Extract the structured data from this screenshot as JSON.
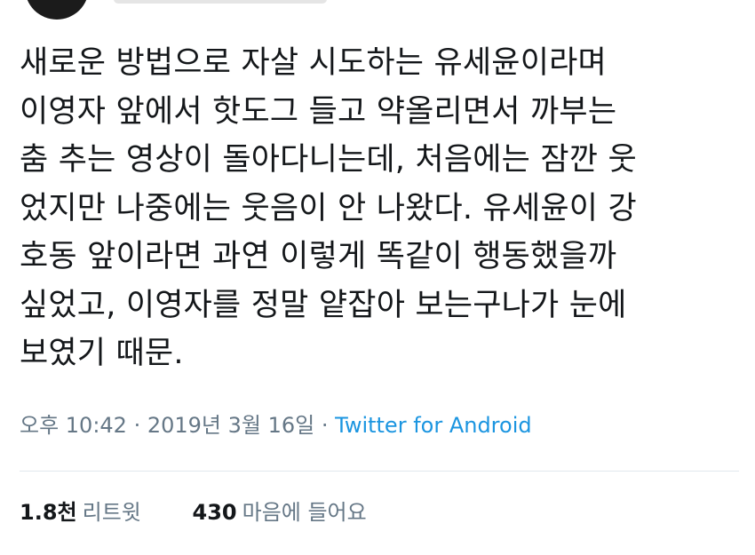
{
  "tweet": {
    "lines": [
      "새로운 방법으로 자살 시도하는 유세윤이라며",
      "이영자 앞에서 핫도그 들고 약올리면서 까부는",
      "춤 추는 영상이 돌아다니는데, 처음에는 잠깐 웃",
      "었지만 나중에는 웃음이 안 나왔다. 유세윤이 강",
      "호동 앞이라면 과연 이렇게 똑같이 행동했을까",
      "싶었고, 이영자를 정말 얕잡아 보는구나가 눈에",
      "보였기 때문."
    ]
  },
  "meta": {
    "time": "오후 10:42",
    "separator1": " · ",
    "date": "2019년 3월 16일",
    "separator2": " · ",
    "source": "Twitter for Android"
  },
  "stats": {
    "retweets_count": "1.8천",
    "retweets_label": "리트윗",
    "likes_count": "430",
    "likes_label": "마음에 들어요"
  },
  "colors": {
    "text": "#14171a",
    "secondary": "#657786",
    "link": "#1b95e0"
  }
}
